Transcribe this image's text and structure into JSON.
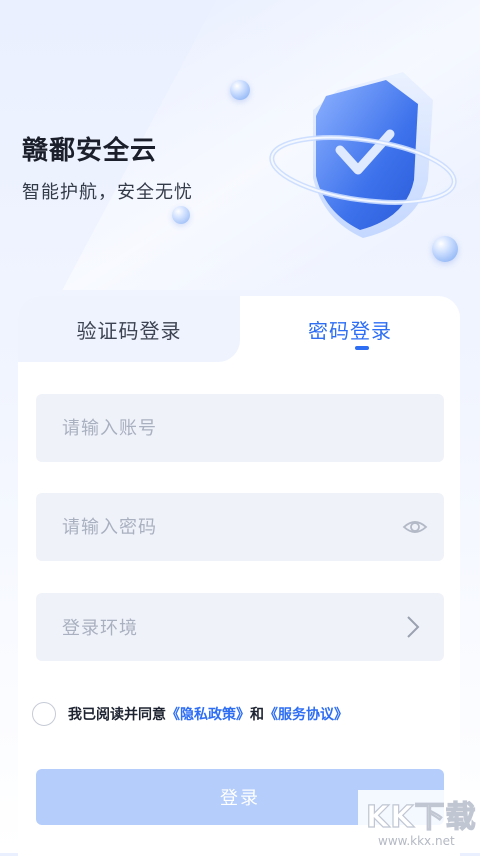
{
  "brand": {
    "title": "赣鄱安全云",
    "subtitle": "智能护航，安全无忧"
  },
  "tabs": [
    {
      "label": "验证码登录",
      "active": false
    },
    {
      "label": "密码登录",
      "active": true
    }
  ],
  "form": {
    "account_placeholder": "请输入账号",
    "password_placeholder": "请输入密码",
    "environment_label": "登录环境"
  },
  "agreement": {
    "prefix": "我已阅读并同意",
    "privacy_link": "《隐私政策》",
    "and": "和",
    "service_link": "《服务协议》",
    "checked": false
  },
  "login_button": "登录",
  "colors": {
    "accent": "#2d6ef5",
    "button_disabled": "#b5cdfb",
    "field_bg": "#eff2f9"
  },
  "icons": {
    "password_toggle": "eye-icon",
    "environment_chevron": "chevron-right-icon",
    "hero": "shield-check-icon"
  },
  "watermark": {
    "logo": "KK下载",
    "url": "www.kkx.net"
  }
}
